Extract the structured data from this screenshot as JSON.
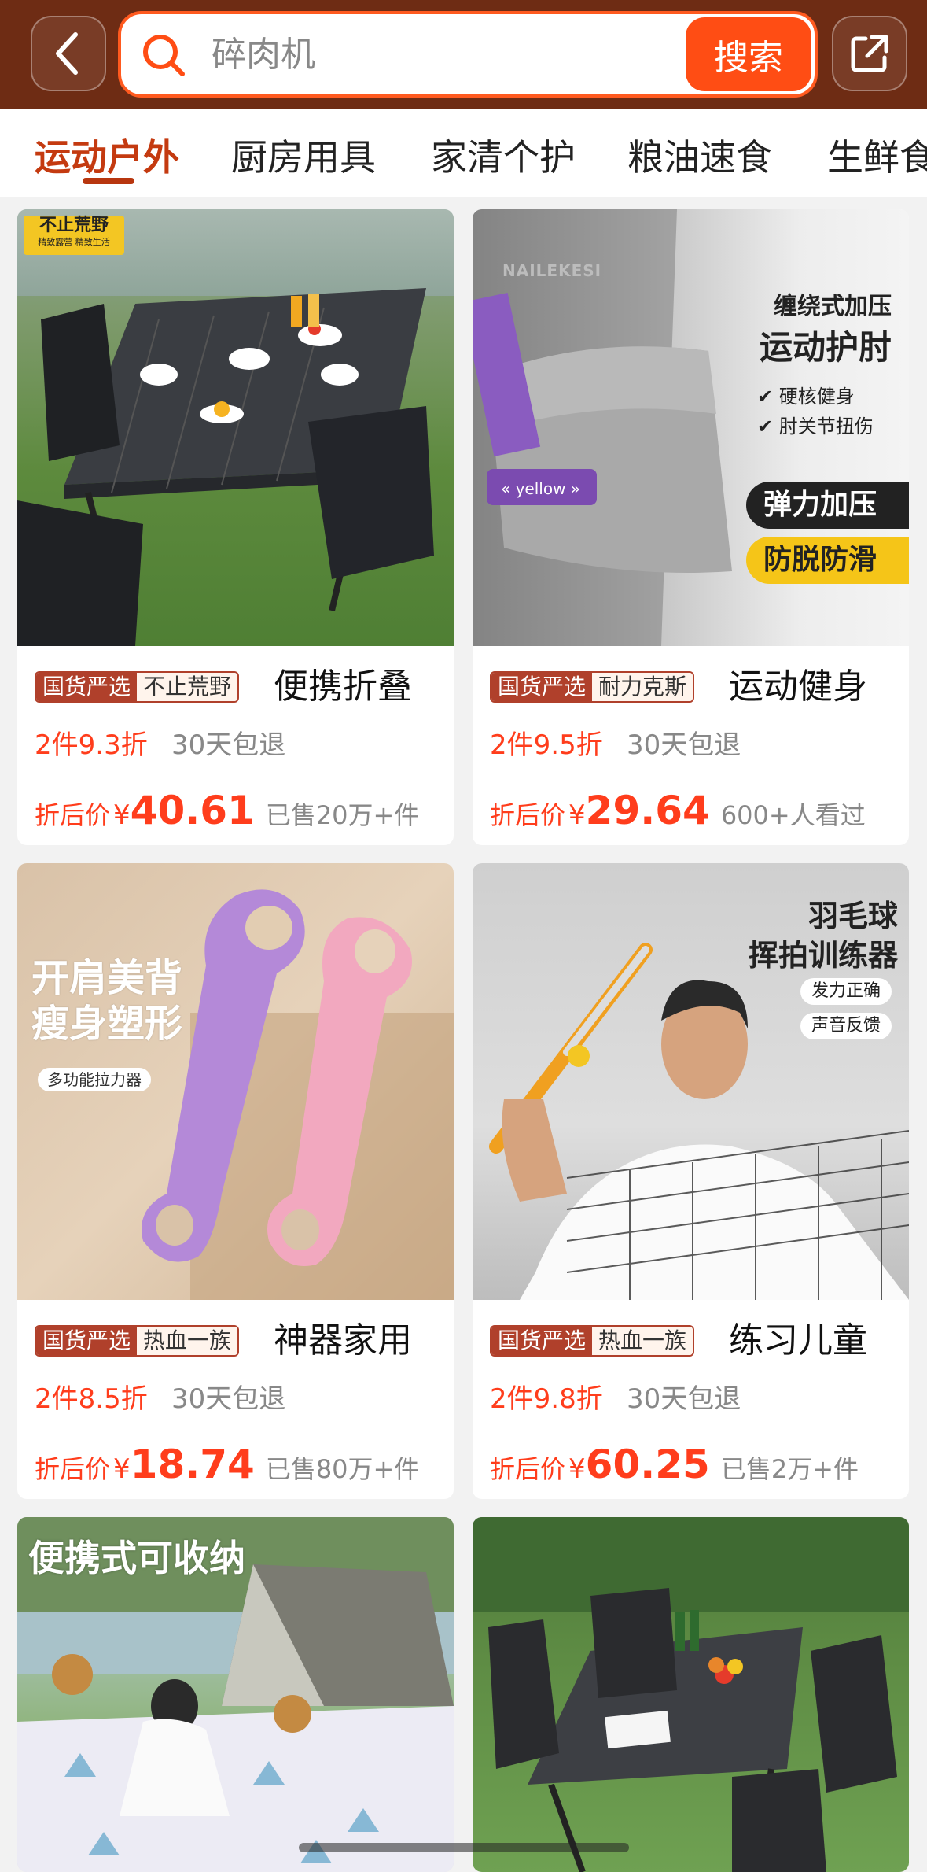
{
  "search": {
    "query": "碎肉机",
    "button": "搜索"
  },
  "tabs": [
    "运动户外",
    "厨房用具",
    "家清个护",
    "粮油速食",
    "生鲜食"
  ],
  "products": [
    {
      "badge_a": "国货严选",
      "badge_b": "不止荒野",
      "title": "便携折叠",
      "promo": "2件9.3折",
      "returns": "30天包退",
      "price_label": "折后价",
      "yen": "¥",
      "price": "40.61",
      "sold": "已售20万+件",
      "image_text": {
        "logo": "不止荒野",
        "logo_sub": "精致露营 精致生活"
      }
    },
    {
      "badge_a": "国货严选",
      "badge_b": "耐力克斯",
      "title": "运动健身",
      "promo": "2件9.5折",
      "returns": "30天包退",
      "price_label": "折后价",
      "yen": "¥",
      "price": "29.64",
      "sold": "600+人看过",
      "image_text": {
        "brand": "NAILEKESI",
        "line1": "缠绕式加压",
        "line2": "运动护肘",
        "check1": "硬核健身",
        "check2": "肘关节扭伤",
        "pill1": "弹力加压",
        "pill2": "防脱防滑"
      }
    },
    {
      "badge_a": "国货严选",
      "badge_b": "热血一族",
      "title": "神器家用",
      "promo": "2件8.5折",
      "returns": "30天包退",
      "price_label": "折后价",
      "yen": "¥",
      "price": "18.74",
      "sold": "已售80万+件",
      "image_text": {
        "line1": "开肩美背",
        "line2": "瘦身塑形",
        "tag": "多功能拉力器"
      }
    },
    {
      "badge_a": "国货严选",
      "badge_b": "热血一族",
      "title": "练习儿童",
      "promo": "2件9.8折",
      "returns": "30天包退",
      "price_label": "折后价",
      "yen": "¥",
      "price": "60.25",
      "sold": "已售2万+件",
      "image_text": {
        "line1": "羽毛球",
        "line2": "挥拍训练器",
        "tag1": "发力正确",
        "tag2": "声音反馈"
      }
    },
    {
      "image_text": {
        "line1": "便携式可收纳"
      }
    },
    {
      "image_text": {}
    }
  ],
  "colors": {
    "header": "#6e2c14",
    "accent": "#ff4d14",
    "price": "#ff3d1c",
    "badge": "#b0402b"
  }
}
